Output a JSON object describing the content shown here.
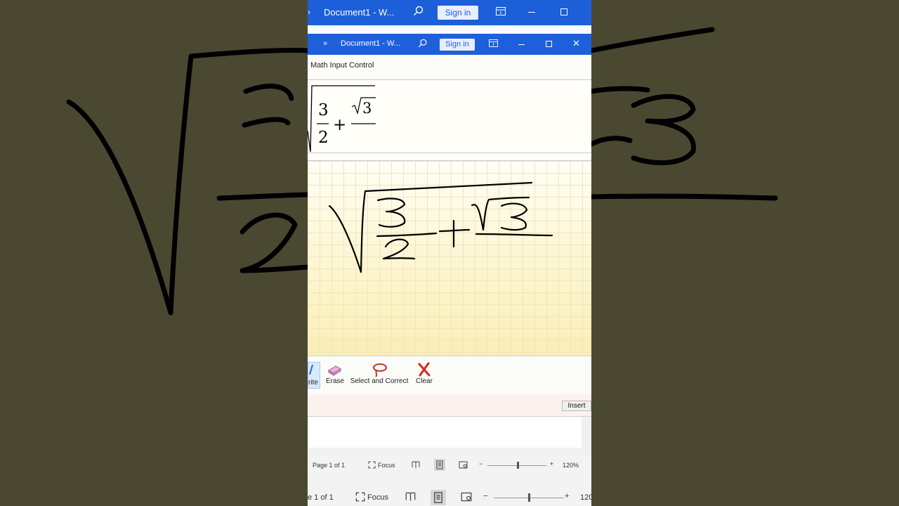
{
  "back_window": {
    "title": "Document1 - W...",
    "sign_in": "Sign in"
  },
  "window": {
    "title": "Document1 - W...",
    "sign_in": "Sign in",
    "chevron": "»"
  },
  "math_input": {
    "title": "Math Input Control",
    "preview": {
      "num": "3",
      "den": "2",
      "plus": "+",
      "sqrt_arg": "3"
    },
    "tools": [
      {
        "label": "rite",
        "icon": "pen-icon"
      },
      {
        "label": "Erase",
        "icon": "eraser-icon"
      },
      {
        "label": "Select and Correct",
        "icon": "lasso-icon"
      },
      {
        "label": "Clear",
        "icon": "x-clear-icon"
      }
    ],
    "insert": "Insert"
  },
  "status_bar": {
    "page": "Page 1 of 1",
    "focus": "Focus",
    "zoom_minus": "−",
    "zoom_plus": "+",
    "zoom": "120%"
  },
  "status_bar_back": {
    "page": "e 1 of 1",
    "focus": "Focus",
    "zoom_minus": "−",
    "zoom_plus": "+",
    "zoom": "120"
  },
  "colors": {
    "titlebar": "#1e60dc",
    "writing_area": "#fdf4cc",
    "background": "#4a4731"
  }
}
